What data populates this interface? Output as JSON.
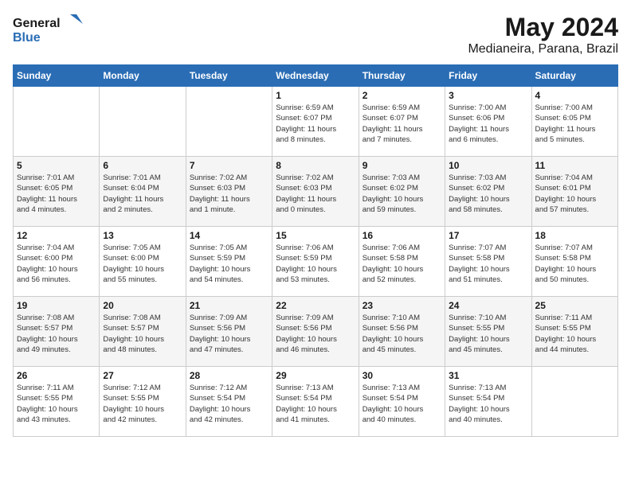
{
  "header": {
    "logo_text_general": "General",
    "logo_text_blue": "Blue",
    "month": "May 2024",
    "location": "Medianeira, Parana, Brazil"
  },
  "days_of_week": [
    "Sunday",
    "Monday",
    "Tuesday",
    "Wednesday",
    "Thursday",
    "Friday",
    "Saturday"
  ],
  "weeks": [
    [
      {
        "day": "",
        "info": ""
      },
      {
        "day": "",
        "info": ""
      },
      {
        "day": "",
        "info": ""
      },
      {
        "day": "1",
        "info": "Sunrise: 6:59 AM\nSunset: 6:07 PM\nDaylight: 11 hours\nand 8 minutes."
      },
      {
        "day": "2",
        "info": "Sunrise: 6:59 AM\nSunset: 6:07 PM\nDaylight: 11 hours\nand 7 minutes."
      },
      {
        "day": "3",
        "info": "Sunrise: 7:00 AM\nSunset: 6:06 PM\nDaylight: 11 hours\nand 6 minutes."
      },
      {
        "day": "4",
        "info": "Sunrise: 7:00 AM\nSunset: 6:05 PM\nDaylight: 11 hours\nand 5 minutes."
      }
    ],
    [
      {
        "day": "5",
        "info": "Sunrise: 7:01 AM\nSunset: 6:05 PM\nDaylight: 11 hours\nand 4 minutes."
      },
      {
        "day": "6",
        "info": "Sunrise: 7:01 AM\nSunset: 6:04 PM\nDaylight: 11 hours\nand 2 minutes."
      },
      {
        "day": "7",
        "info": "Sunrise: 7:02 AM\nSunset: 6:03 PM\nDaylight: 11 hours\nand 1 minute."
      },
      {
        "day": "8",
        "info": "Sunrise: 7:02 AM\nSunset: 6:03 PM\nDaylight: 11 hours\nand 0 minutes."
      },
      {
        "day": "9",
        "info": "Sunrise: 7:03 AM\nSunset: 6:02 PM\nDaylight: 10 hours\nand 59 minutes."
      },
      {
        "day": "10",
        "info": "Sunrise: 7:03 AM\nSunset: 6:02 PM\nDaylight: 10 hours\nand 58 minutes."
      },
      {
        "day": "11",
        "info": "Sunrise: 7:04 AM\nSunset: 6:01 PM\nDaylight: 10 hours\nand 57 minutes."
      }
    ],
    [
      {
        "day": "12",
        "info": "Sunrise: 7:04 AM\nSunset: 6:00 PM\nDaylight: 10 hours\nand 56 minutes."
      },
      {
        "day": "13",
        "info": "Sunrise: 7:05 AM\nSunset: 6:00 PM\nDaylight: 10 hours\nand 55 minutes."
      },
      {
        "day": "14",
        "info": "Sunrise: 7:05 AM\nSunset: 5:59 PM\nDaylight: 10 hours\nand 54 minutes."
      },
      {
        "day": "15",
        "info": "Sunrise: 7:06 AM\nSunset: 5:59 PM\nDaylight: 10 hours\nand 53 minutes."
      },
      {
        "day": "16",
        "info": "Sunrise: 7:06 AM\nSunset: 5:58 PM\nDaylight: 10 hours\nand 52 minutes."
      },
      {
        "day": "17",
        "info": "Sunrise: 7:07 AM\nSunset: 5:58 PM\nDaylight: 10 hours\nand 51 minutes."
      },
      {
        "day": "18",
        "info": "Sunrise: 7:07 AM\nSunset: 5:58 PM\nDaylight: 10 hours\nand 50 minutes."
      }
    ],
    [
      {
        "day": "19",
        "info": "Sunrise: 7:08 AM\nSunset: 5:57 PM\nDaylight: 10 hours\nand 49 minutes."
      },
      {
        "day": "20",
        "info": "Sunrise: 7:08 AM\nSunset: 5:57 PM\nDaylight: 10 hours\nand 48 minutes."
      },
      {
        "day": "21",
        "info": "Sunrise: 7:09 AM\nSunset: 5:56 PM\nDaylight: 10 hours\nand 47 minutes."
      },
      {
        "day": "22",
        "info": "Sunrise: 7:09 AM\nSunset: 5:56 PM\nDaylight: 10 hours\nand 46 minutes."
      },
      {
        "day": "23",
        "info": "Sunrise: 7:10 AM\nSunset: 5:56 PM\nDaylight: 10 hours\nand 45 minutes."
      },
      {
        "day": "24",
        "info": "Sunrise: 7:10 AM\nSunset: 5:55 PM\nDaylight: 10 hours\nand 45 minutes."
      },
      {
        "day": "25",
        "info": "Sunrise: 7:11 AM\nSunset: 5:55 PM\nDaylight: 10 hours\nand 44 minutes."
      }
    ],
    [
      {
        "day": "26",
        "info": "Sunrise: 7:11 AM\nSunset: 5:55 PM\nDaylight: 10 hours\nand 43 minutes."
      },
      {
        "day": "27",
        "info": "Sunrise: 7:12 AM\nSunset: 5:55 PM\nDaylight: 10 hours\nand 42 minutes."
      },
      {
        "day": "28",
        "info": "Sunrise: 7:12 AM\nSunset: 5:54 PM\nDaylight: 10 hours\nand 42 minutes."
      },
      {
        "day": "29",
        "info": "Sunrise: 7:13 AM\nSunset: 5:54 PM\nDaylight: 10 hours\nand 41 minutes."
      },
      {
        "day": "30",
        "info": "Sunrise: 7:13 AM\nSunset: 5:54 PM\nDaylight: 10 hours\nand 40 minutes."
      },
      {
        "day": "31",
        "info": "Sunrise: 7:13 AM\nSunset: 5:54 PM\nDaylight: 10 hours\nand 40 minutes."
      },
      {
        "day": "",
        "info": ""
      }
    ]
  ]
}
